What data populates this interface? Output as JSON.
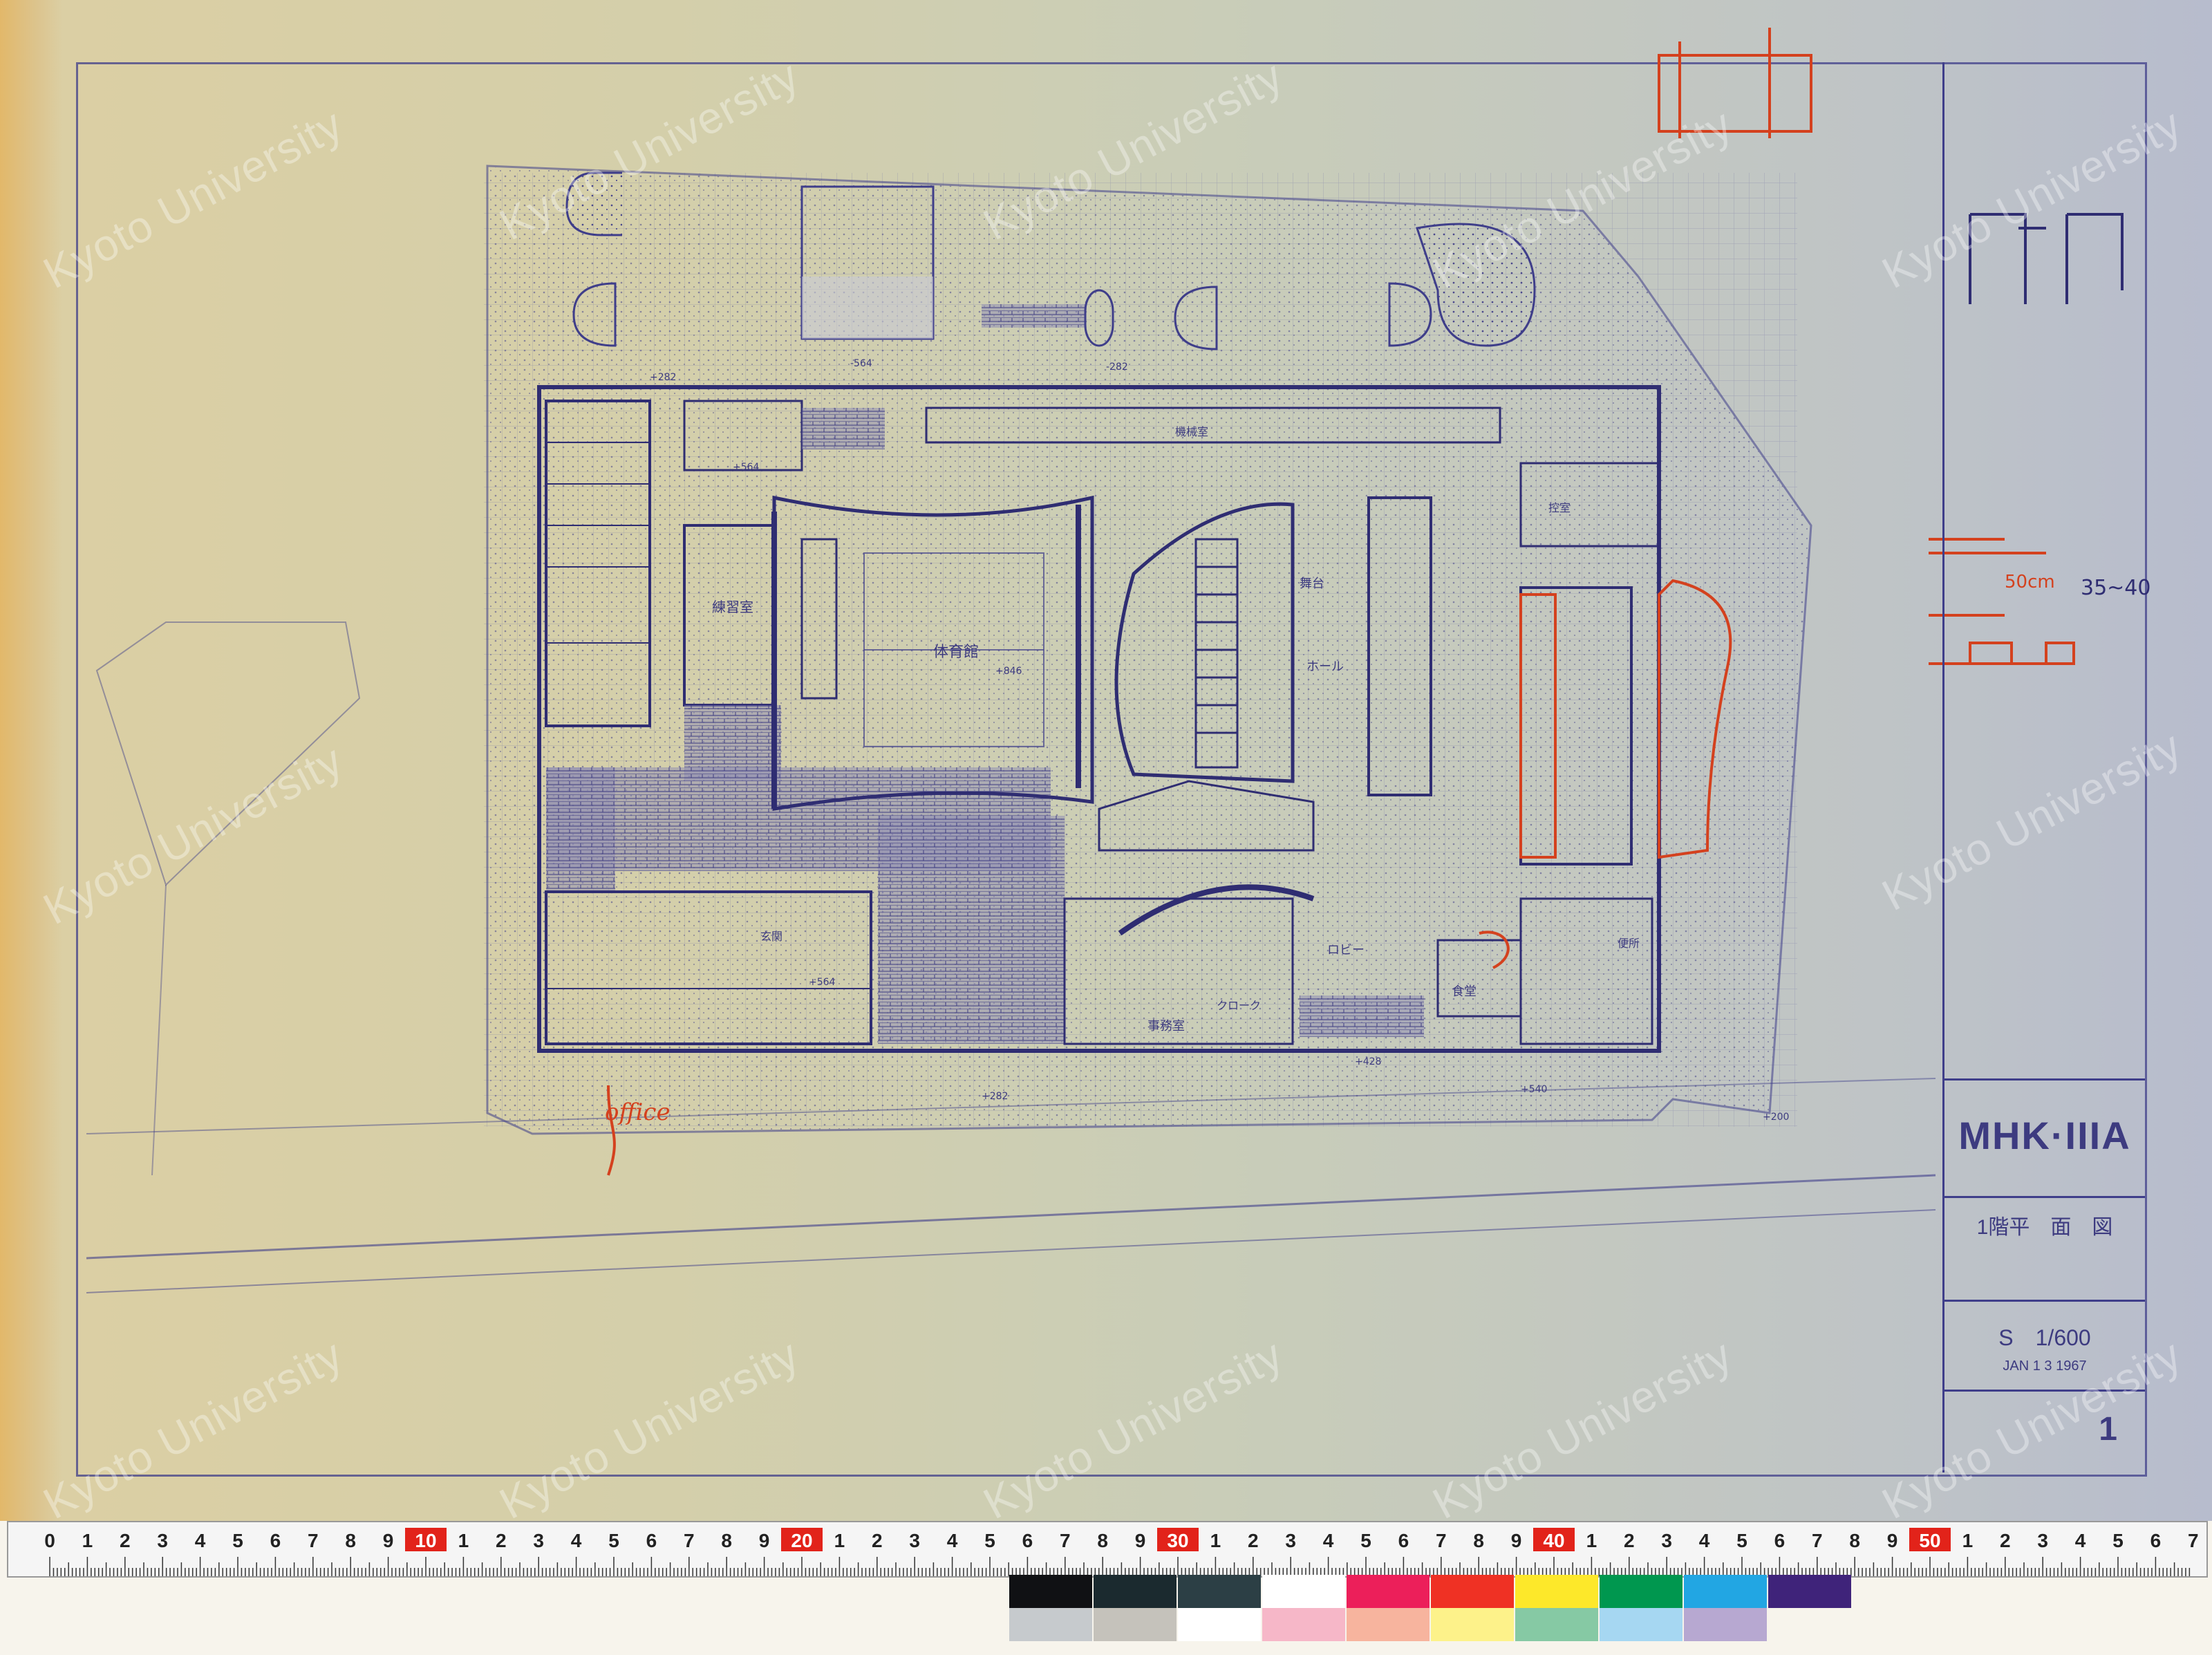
{
  "title_block": {
    "project": "MHK·IIIA",
    "drawing_title": "1階平　面　図",
    "scale": "S　1/600",
    "date": "JAN 1 3 1967",
    "sheet_no": "1"
  },
  "watermark": "Kyoto University",
  "annotations": {
    "office_note": "office",
    "dim_note_a": "50cm",
    "dim_note_b": "35~40"
  },
  "plan_labels": {
    "gym": "体育館",
    "practice_room": "練習室",
    "hall": "ホール",
    "office_room": "事務室",
    "entrance": "玄関",
    "restaurant": "食堂",
    "lobby": "ロビー",
    "cloak": "クローク",
    "stage": "舞台",
    "machine_room": "機械室",
    "toilet": "便所",
    "waiting": "控室"
  },
  "levels": [
    "+282",
    "-564",
    "-282",
    "+564",
    "+846",
    "+564",
    "+282",
    "+200",
    "+540",
    "+428"
  ],
  "ruler": {
    "labels": [
      "0",
      "1",
      "2",
      "3",
      "4",
      "5",
      "6",
      "7",
      "8",
      "9",
      "10",
      "1",
      "2",
      "3",
      "4",
      "5",
      "6",
      "7",
      "8",
      "9",
      "20",
      "1",
      "2",
      "3",
      "4",
      "5",
      "6",
      "7",
      "8",
      "9",
      "30",
      "1",
      "2",
      "3",
      "4",
      "5",
      "6",
      "7",
      "8",
      "9",
      "40",
      "1",
      "2",
      "3",
      "4",
      "5",
      "6",
      "7",
      "8",
      "9",
      "50",
      "1",
      "2",
      "3",
      "4",
      "5",
      "6",
      "7"
    ],
    "highlight": [
      "10",
      "20",
      "30",
      "40",
      "50"
    ],
    "unit_hint": "1m"
  },
  "color_patches": {
    "top": [
      "#101114",
      "#1b2a2f",
      "#2c3f45",
      "#ffffff",
      "#ec1f5a",
      "#ef3124",
      "#fde82a",
      "#00974f",
      "#22a6e3",
      "#3f237a"
    ],
    "bottom": [
      "#c6cacd",
      "#c5c2bb",
      "#ffffff",
      "#f6b7c8",
      "#f7b49e",
      "#fdf28a",
      "#86c9a4",
      "#a6d7f2",
      "#b7a8d1"
    ]
  }
}
